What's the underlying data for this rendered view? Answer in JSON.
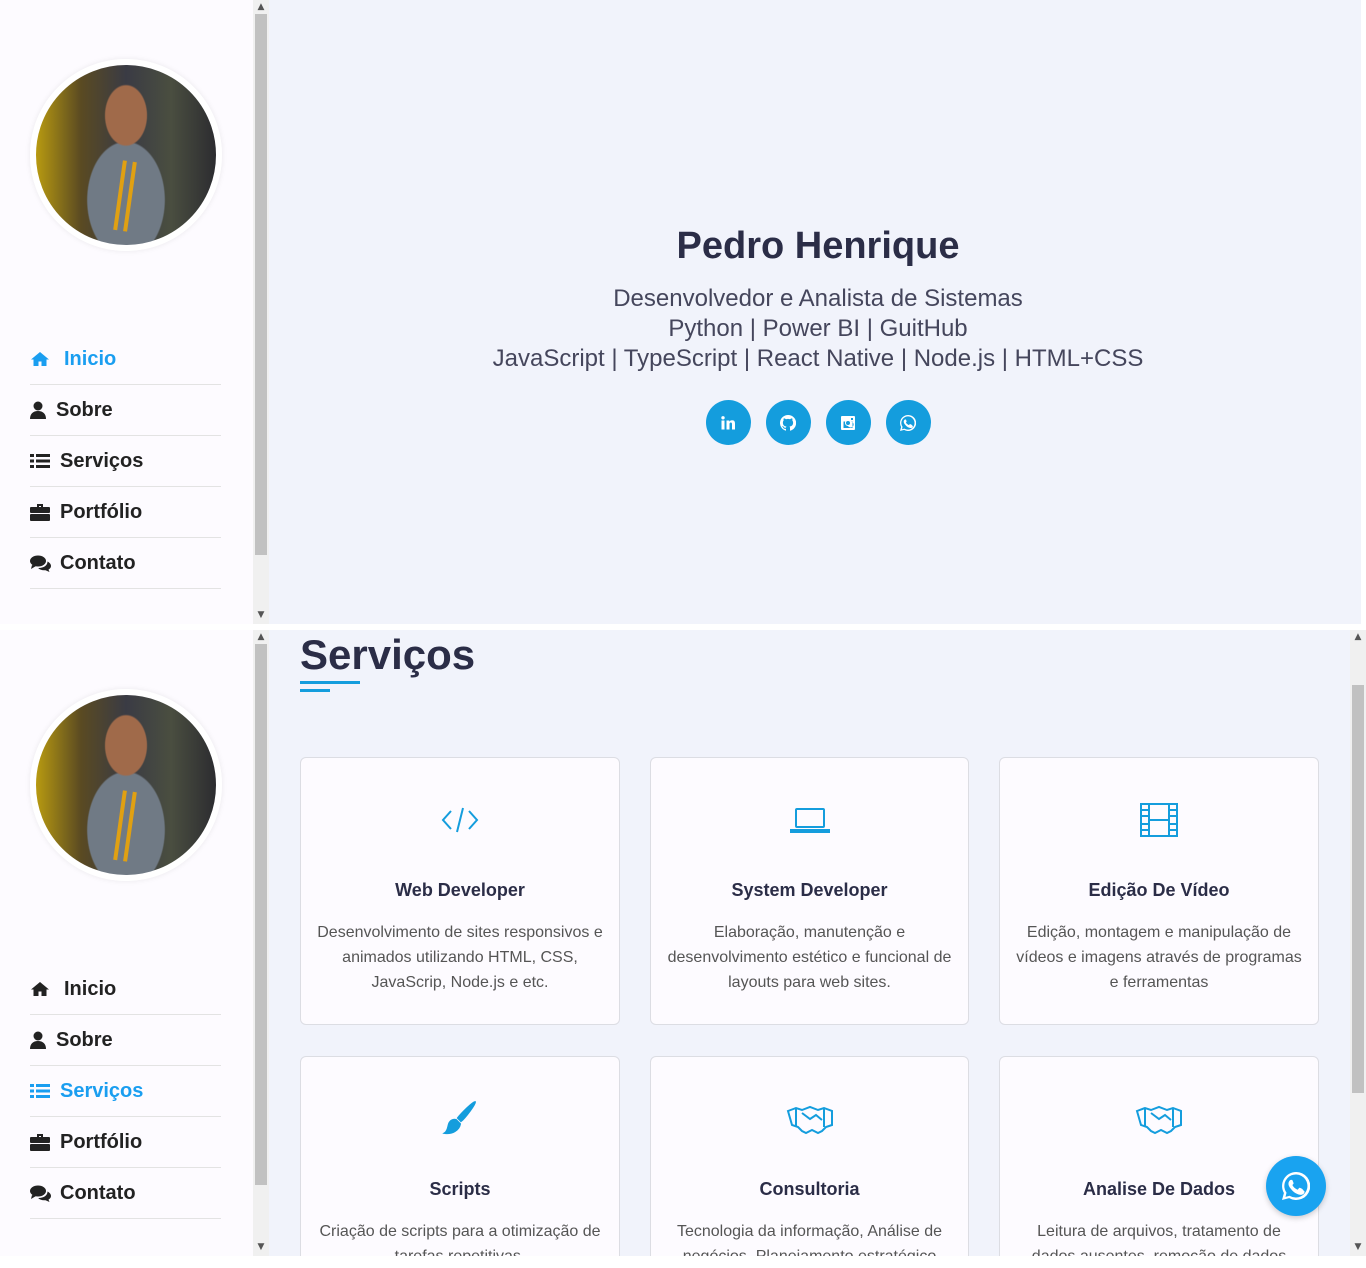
{
  "sidebar": {
    "nav": [
      {
        "label": "Inicio",
        "icon": "home-icon"
      },
      {
        "label": "Sobre",
        "icon": "user-icon"
      },
      {
        "label": "Serviços",
        "icon": "list-icon"
      },
      {
        "label": "Portfólio",
        "icon": "briefcase-icon"
      },
      {
        "label": "Contato",
        "icon": "comments-icon"
      }
    ],
    "avatar": "profile-photo"
  },
  "hero": {
    "name": "Pedro Henrique",
    "line1": "Desenvolvedor e Analista de Sistemas",
    "line2": "Python | Power BI | GuitHub",
    "line3": "JavaScript | TypeScript | React Native | Node.js | HTML+CSS",
    "socials": [
      "linkedin-icon",
      "github-icon",
      "instagram-icon",
      "whatsapp-icon"
    ]
  },
  "services": {
    "title": "Serviços",
    "cards": [
      {
        "title": "Web Developer",
        "text": "Desenvolvimento de sites responsivos e animados utilizando HTML, CSS, JavaScrip, Node.js e etc.",
        "icon": "code-icon"
      },
      {
        "title": "System Developer",
        "text": "Elaboração, manutenção e desenvolvimento estético e funcional de layouts para web sites.",
        "icon": "laptop-icon"
      },
      {
        "title": "Edição De Vídeo",
        "text": "Edição, montagem e manipulação de vídeos e imagens através de programas e ferramentas",
        "icon": "film-icon"
      },
      {
        "title": "Scripts",
        "text": "Criação de scripts para a otimização de tarefas repetitivas.",
        "icon": "brush-icon"
      },
      {
        "title": "Consultoria",
        "text": "Tecnologia da informação, Análise de negócios, Planejamento estratégico",
        "icon": "handshake-icon"
      },
      {
        "title": "Analise De Dados",
        "text": "Leitura de arquivos, tratamento de dados ausentes, remoção de dados",
        "icon": "handshake-icon"
      }
    ]
  },
  "colors": {
    "accent": "#149ddd",
    "heading": "#2b2d47",
    "bg": "#f1f3fb"
  }
}
